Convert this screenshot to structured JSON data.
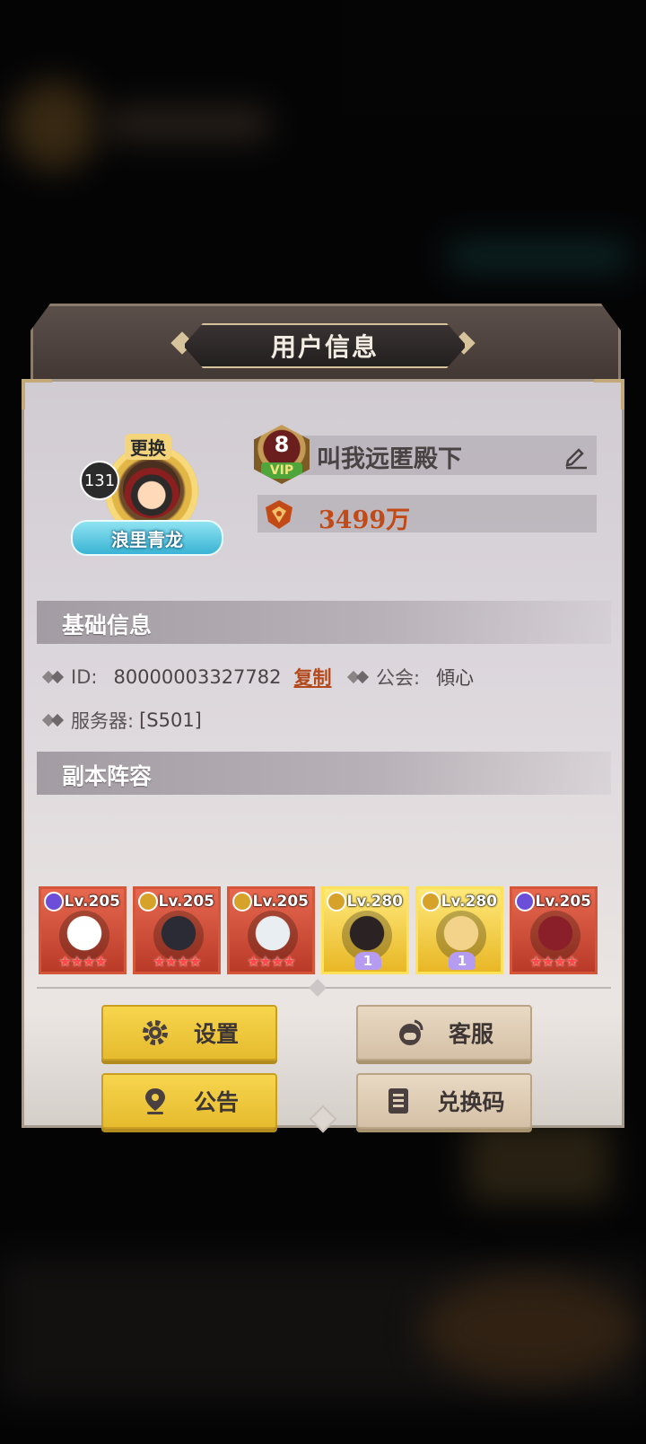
{
  "dialog": {
    "title": "用户信息",
    "avatar": {
      "level": "131",
      "change_label": "更换",
      "title_banner": "浪里青龙"
    },
    "vip": {
      "level": "8",
      "label": "VIP"
    },
    "player_name": "叫我远匿殿下",
    "power": "3499万",
    "basic_info": {
      "header": "基础信息",
      "id_label": "ID:",
      "id_value": "80000003327782",
      "copy_label": "复制",
      "guild_label": "公会:",
      "guild_value": "傾心",
      "server_label": "服务器:",
      "server_value": "[S501]"
    },
    "lineup": {
      "header": "副本阵容",
      "heroes": [
        {
          "level": "Lv.205",
          "rarity": "red",
          "stars": "★★★★",
          "class_color": "#6b4fd8",
          "art_color": "#ffffff"
        },
        {
          "level": "Lv.205",
          "rarity": "red",
          "stars": "★★★★",
          "class_color": "#d7a22a",
          "art_color": "#2b2b35"
        },
        {
          "level": "Lv.205",
          "rarity": "red",
          "stars": "★★★★",
          "class_color": "#d7a22a",
          "art_color": "#e9eef2"
        },
        {
          "level": "Lv.280",
          "rarity": "gold",
          "badge": "1",
          "class_color": "#d7a22a",
          "art_color": "#2b2224"
        },
        {
          "level": "Lv.280",
          "rarity": "gold",
          "badge": "1",
          "class_color": "#d7a22a",
          "art_color": "#f3d38a"
        },
        {
          "level": "Lv.205",
          "rarity": "red",
          "stars": "★★★★",
          "class_color": "#6b4fd8",
          "art_color": "#8a1f2a"
        }
      ]
    },
    "buttons": {
      "settings": "设置",
      "service": "客服",
      "notice": "公告",
      "redeem": "兑换码"
    }
  },
  "colors": {
    "accent_yellow": "#f6d54d",
    "accent_beige": "#e9d9c3",
    "power_text": "#c24a17",
    "copy_link": "#b34a1e"
  },
  "icons": [
    "edit-icon",
    "power-icon",
    "gear-icon",
    "headset-icon",
    "location-icon",
    "codebook-icon"
  ]
}
